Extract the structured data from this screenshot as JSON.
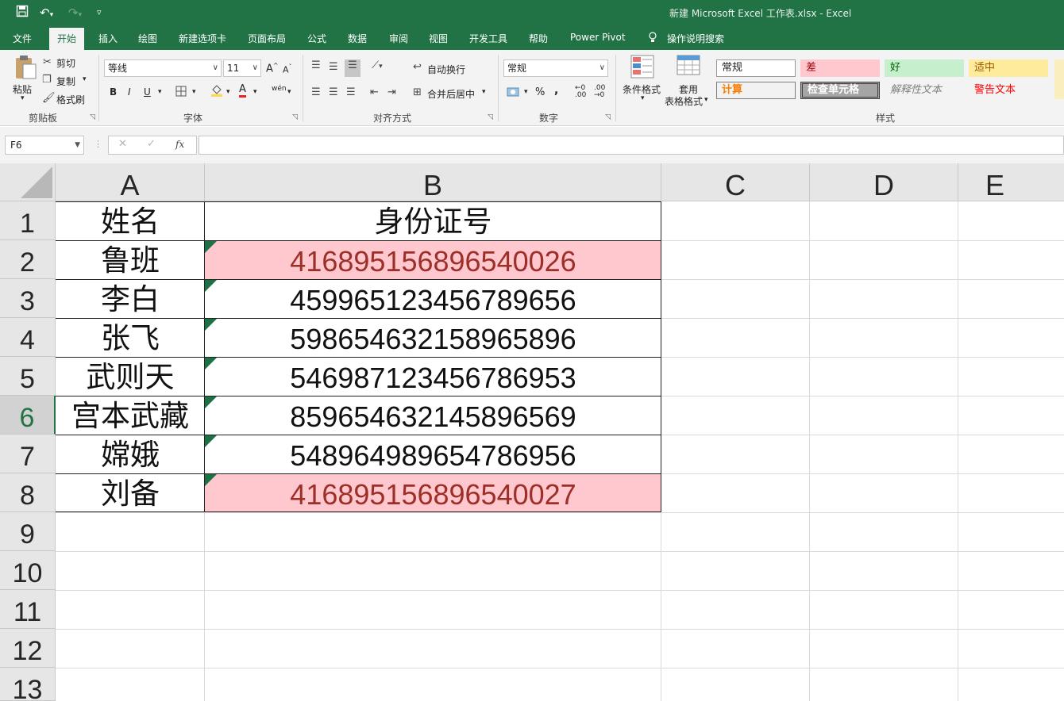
{
  "app": {
    "window_title": "新建 Microsoft Excel 工作表.xlsx  -  Excel"
  },
  "menu": {
    "tabs": [
      "文件",
      "开始",
      "插入",
      "绘图",
      "新建选项卡",
      "页面布局",
      "公式",
      "数据",
      "审阅",
      "视图",
      "开发工具",
      "帮助",
      "Power Pivot"
    ],
    "active_tab": "开始",
    "tell_me": "操作说明搜索"
  },
  "ribbon": {
    "clipboard": {
      "paste": "粘贴",
      "cut": "剪切",
      "copy": "复制",
      "format_painter": "格式刷",
      "group_label": "剪贴板"
    },
    "font": {
      "font_name": "等线",
      "font_size": "11",
      "grow_font": "A",
      "shrink_font": "A",
      "bold": "B",
      "italic": "I",
      "underline": "U",
      "font_color_letter": "A",
      "wen": "wén",
      "group_label": "字体"
    },
    "alignment": {
      "wrap_text": "自动换行",
      "merge_center": "合并后居中",
      "group_label": "对齐方式"
    },
    "number": {
      "format": "常规",
      "percent": "%",
      "comma": ",",
      "group_label": "数字"
    },
    "styles": {
      "conditional_format": "条件格式",
      "table_format_line1": "套用",
      "table_format_line2": "表格格式",
      "cells": [
        {
          "label": "常规",
          "bg": "#ffffff",
          "color": "#222222"
        },
        {
          "label": "差",
          "bg": "#ffc7ce",
          "color": "#9c0006"
        },
        {
          "label": "好",
          "bg": "#c6efce",
          "color": "#006100"
        },
        {
          "label": "适中",
          "bg": "#ffeb9c",
          "color": "#9c5700"
        },
        {
          "label": "计算",
          "bg": "#f2f2f2",
          "color": "#fa7d00"
        },
        {
          "label": "检查单元格",
          "bg": "#a5a5a5",
          "color": "#ffffff"
        },
        {
          "label": "解释性文本",
          "bg": "#f3f3f3",
          "color": "#7f7f7f"
        },
        {
          "label": "警告文本",
          "bg": "#f3f3f3",
          "color": "#ff0000"
        }
      ],
      "group_label": "样式"
    }
  },
  "formula_bar": {
    "name_box": "F6",
    "cancel": "✕",
    "enter": "✓",
    "fx": "fx",
    "value": ""
  },
  "sheet": {
    "columns": [
      "A",
      "B",
      "C",
      "D",
      "E"
    ],
    "row_numbers": [
      "1",
      "2",
      "3",
      "4",
      "5",
      "6",
      "7",
      "8",
      "9",
      "10",
      "11",
      "12",
      "13"
    ],
    "selected_row": "6",
    "header": {
      "name": "姓名",
      "id": "身份证号"
    },
    "records": [
      {
        "name": "鲁班",
        "id": "416895156896540026",
        "duplicate": true
      },
      {
        "name": "李白",
        "id": "459965123456789656",
        "duplicate": false
      },
      {
        "name": "张飞",
        "id": "598654632158965896",
        "duplicate": false
      },
      {
        "name": "武则天",
        "id": "546987123456786953",
        "duplicate": false
      },
      {
        "name": "宫本武藏",
        "id": "859654632145896569",
        "duplicate": false
      },
      {
        "name": "嫦娥",
        "id": "548964989654786956",
        "duplicate": false
      },
      {
        "name": "刘备",
        "id": "416895156896540027",
        "duplicate": true
      }
    ],
    "duplicate_fill": "#ffc7ce",
    "duplicate_text": "#9c2f28"
  }
}
